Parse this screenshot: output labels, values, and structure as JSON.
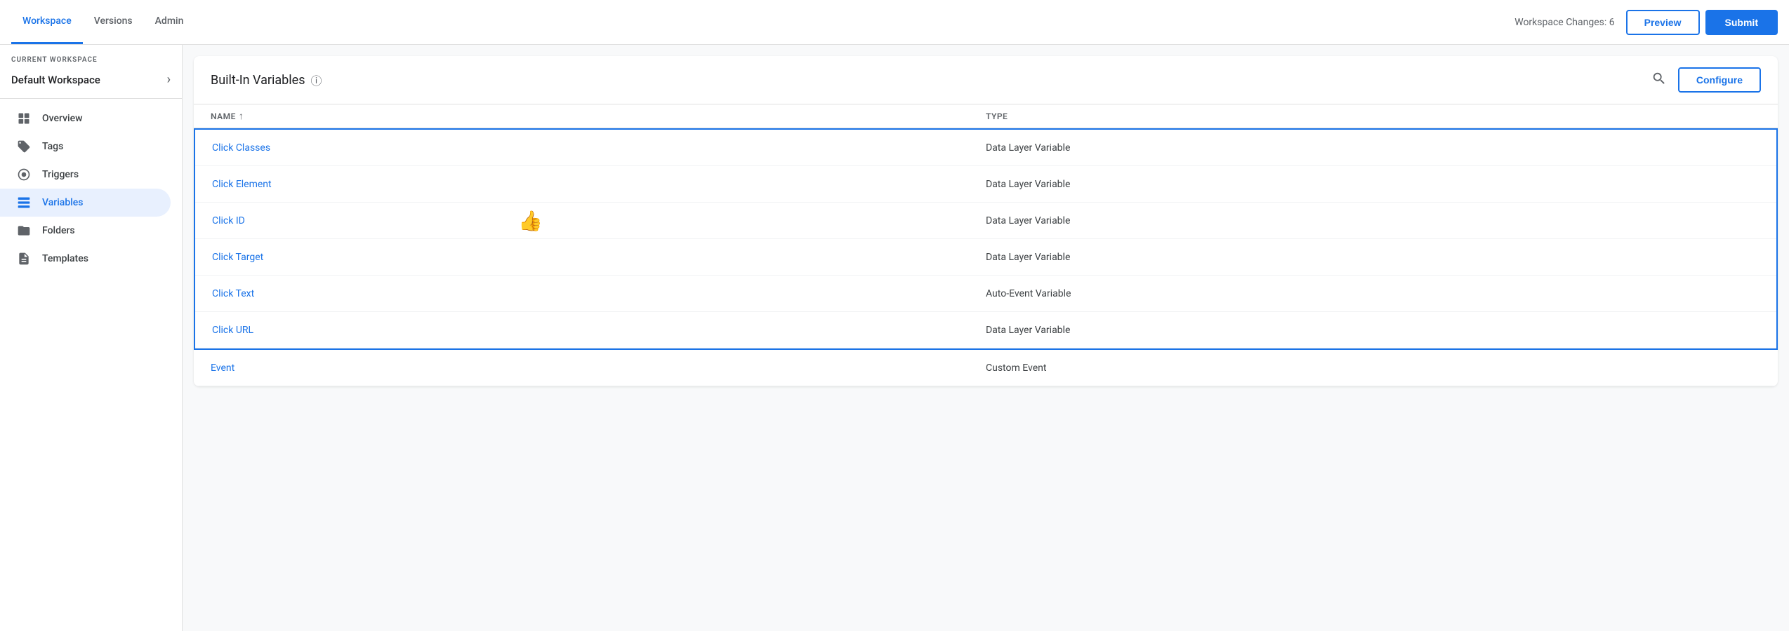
{
  "topNav": {
    "tabs": [
      {
        "id": "workspace",
        "label": "Workspace",
        "active": true
      },
      {
        "id": "versions",
        "label": "Versions",
        "active": false
      },
      {
        "id": "admin",
        "label": "Admin",
        "active": false
      }
    ],
    "workspaceChanges": "Workspace Changes: 6",
    "previewLabel": "Preview",
    "submitLabel": "Submit"
  },
  "sidebar": {
    "currentWorkspaceLabel": "CURRENT WORKSPACE",
    "workspaceName": "Default Workspace",
    "items": [
      {
        "id": "overview",
        "label": "Overview",
        "icon": "⬜",
        "active": false
      },
      {
        "id": "tags",
        "label": "Tags",
        "icon": "🏷",
        "active": false
      },
      {
        "id": "triggers",
        "label": "Triggers",
        "icon": "⚙",
        "active": false
      },
      {
        "id": "variables",
        "label": "Variables",
        "icon": "📦",
        "active": true
      },
      {
        "id": "folders",
        "label": "Folders",
        "icon": "📁",
        "active": false
      },
      {
        "id": "templates",
        "label": "Templates",
        "icon": "📄",
        "active": false
      }
    ]
  },
  "main": {
    "title": "Built-In Variables",
    "configureLabel": "Configure",
    "columns": [
      {
        "label": "Name",
        "sortable": true
      },
      {
        "label": "Type",
        "sortable": false
      }
    ],
    "rows": [
      {
        "name": "Click Classes",
        "type": "Data Layer Variable",
        "selected": true
      },
      {
        "name": "Click Element",
        "type": "Data Layer Variable",
        "selected": true
      },
      {
        "name": "Click ID",
        "type": "Data Layer Variable",
        "selected": true,
        "hasEmoji": true
      },
      {
        "name": "Click Target",
        "type": "Data Layer Variable",
        "selected": true
      },
      {
        "name": "Click Text",
        "type": "Auto-Event Variable",
        "selected": true
      },
      {
        "name": "Click URL",
        "type": "Data Layer Variable",
        "selected": true
      },
      {
        "name": "Event",
        "type": "Custom Event",
        "selected": false
      }
    ]
  }
}
